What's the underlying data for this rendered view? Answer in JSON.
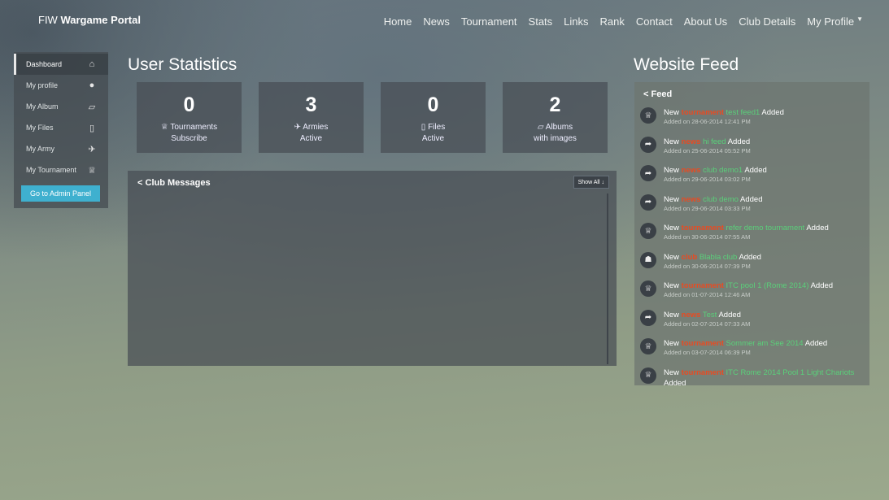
{
  "brand": {
    "prefix": "FIW",
    "name": "Wargame Portal"
  },
  "nav": [
    "Home",
    "News",
    "Tournament",
    "Stats",
    "Links",
    "Rank",
    "Contact",
    "About Us",
    "Club Details",
    "My Profile"
  ],
  "sidebar": {
    "items": [
      {
        "label": "Dashboard",
        "icon": "home-icon",
        "glyph": "⌂"
      },
      {
        "label": "My profile",
        "icon": "user-icon",
        "glyph": "●"
      },
      {
        "label": "My Album",
        "icon": "folder-open-icon",
        "glyph": "▱"
      },
      {
        "label": "My Files",
        "icon": "file-icon",
        "glyph": "▯"
      },
      {
        "label": "My Army",
        "icon": "plane-icon",
        "glyph": "✈"
      },
      {
        "label": "My Tournament",
        "icon": "trophy-icon",
        "glyph": "♕"
      }
    ],
    "admin_button": "Go to Admin Panel"
  },
  "user_stats": {
    "title": "User Statistics",
    "cards": [
      {
        "value": "0",
        "icon": "trophy-icon",
        "glyph": "♕",
        "line1": "Tournaments",
        "line2": "Subscribe"
      },
      {
        "value": "3",
        "icon": "plane-icon",
        "glyph": "✈",
        "line1": "Armies",
        "line2": "Active"
      },
      {
        "value": "0",
        "icon": "file-icon",
        "glyph": "▯",
        "line1": "Files",
        "line2": "Active"
      },
      {
        "value": "2",
        "icon": "folder-open-icon",
        "glyph": "▱",
        "line1": "Albums",
        "line2": "with images"
      }
    ]
  },
  "club_messages": {
    "title": "Club Messages",
    "show_all": "Show All"
  },
  "website_feed": {
    "title": "Website Feed",
    "panel_title": "Feed",
    "items": [
      {
        "icon": "trophy-icon",
        "glyph": "♕",
        "prefix": "New",
        "type": "tournament",
        "name": "test feed1",
        "suffix": "Added",
        "date": "Added on 28-06-2014 12:41 PM"
      },
      {
        "icon": "share-icon",
        "glyph": "➦",
        "prefix": "New",
        "type": "news",
        "name": "hi feed",
        "suffix": "Added",
        "date": "Added on 25-06-2014 05:52 PM"
      },
      {
        "icon": "share-icon",
        "glyph": "➦",
        "prefix": "New",
        "type": "news",
        "name": "club demo1",
        "suffix": "Added",
        "date": "Added on 29-06-2014 03:02 PM"
      },
      {
        "icon": "share-icon",
        "glyph": "➦",
        "prefix": "New",
        "type": "news",
        "name": "club demo",
        "suffix": "Added",
        "date": "Added on 29-06-2014 03:33 PM"
      },
      {
        "icon": "trophy-icon",
        "glyph": "♕",
        "prefix": "New",
        "type": "tournament",
        "name": "refer demo tournament",
        "suffix": "Added",
        "date": "Added on 30-06-2014 07:55 AM"
      },
      {
        "icon": "users-icon",
        "glyph": "☗",
        "prefix": "New",
        "type": "club",
        "name": "Blabla club",
        "suffix": "Added",
        "date": "Added on 30-06-2014 07:39 PM"
      },
      {
        "icon": "trophy-icon",
        "glyph": "♕",
        "prefix": "New",
        "type": "tournament",
        "name": "ITC pool 1 (Rome 2014)",
        "suffix": "Added",
        "date": "Added on 01-07-2014 12:46 AM"
      },
      {
        "icon": "share-icon",
        "glyph": "➦",
        "prefix": "New",
        "type": "news",
        "name": "Test",
        "suffix": "Added",
        "date": "Added on 02-07-2014 07:33 AM"
      },
      {
        "icon": "trophy-icon",
        "glyph": "♕",
        "prefix": "New",
        "type": "tournament",
        "name": "Sommer am See 2014",
        "suffix": "Added",
        "date": "Added on 03-07-2014 06:39 PM"
      },
      {
        "icon": "trophy-icon",
        "glyph": "♕",
        "prefix": "New",
        "type": "tournament",
        "name": "ITC Rome 2014 Pool 1 Light Chariots",
        "suffix": "Added",
        "date": "Added on 05-07-2014 07:21 PM"
      }
    ]
  },
  "colors": {
    "accent": "#3fb0cf",
    "feed_type": "#e84b22",
    "feed_name": "#5ad07a"
  }
}
